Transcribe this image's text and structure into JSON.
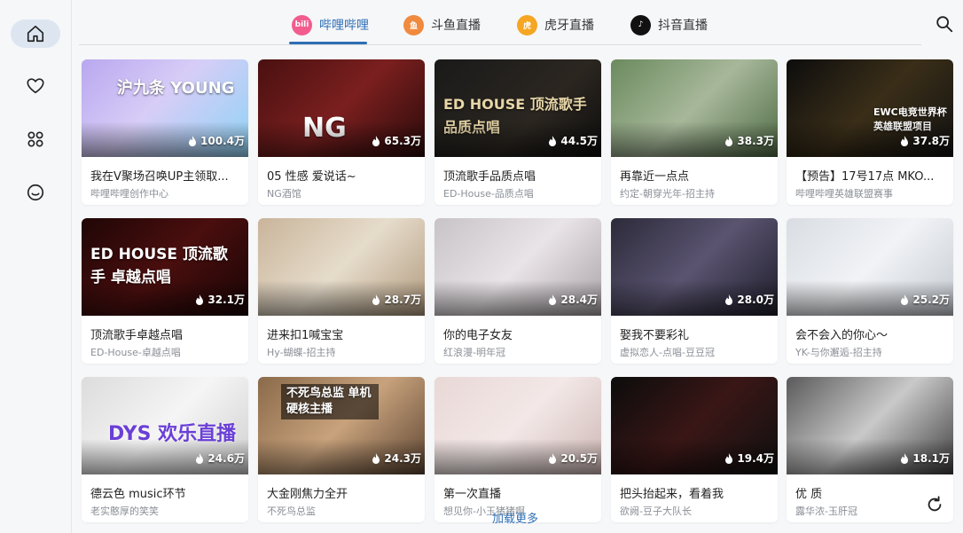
{
  "sidebar": {
    "items": [
      {
        "icon": "home-icon",
        "active": true
      },
      {
        "icon": "heart-icon",
        "active": false
      },
      {
        "icon": "grid-icon",
        "active": false
      },
      {
        "icon": "smile-icon",
        "active": false
      }
    ]
  },
  "tabs": [
    {
      "label": "哔哩哔哩",
      "icon": "bilibili-icon",
      "icon_text": "bili",
      "color": "#f25d8e",
      "active": true
    },
    {
      "label": "斗鱼直播",
      "icon": "douyu-icon",
      "icon_text": "鱼",
      "color": "#f08a3e",
      "active": false
    },
    {
      "label": "虎牙直播",
      "icon": "huya-icon",
      "icon_text": "虎",
      "color": "#f5a623",
      "active": false
    },
    {
      "label": "抖音直播",
      "icon": "douyin-icon",
      "icon_text": "♪",
      "color": "#111111",
      "active": false
    }
  ],
  "accent_color": "#2f6fb5",
  "cards": [
    {
      "title": "我在V聚场召唤UP主领取...",
      "streamer": "哔哩哔哩创作中心",
      "viewers": "100.4万",
      "overlay": "沪九条 YOUNG"
    },
    {
      "title": "05 性感 爱说话~",
      "streamer": "NG酒馆",
      "viewers": "65.3万",
      "overlay": "NG"
    },
    {
      "title": "顶流歌手品质点唱",
      "streamer": "ED-House-品质点唱",
      "viewers": "44.5万",
      "overlay": "ED HOUSE 顶流歌手 品质点唱"
    },
    {
      "title": "再靠近一点点",
      "streamer": "约定-朝穿光年-招主持",
      "viewers": "38.3万",
      "overlay": ""
    },
    {
      "title": "【预告】17号17点 MKO...",
      "streamer": "哔哩哔哩英雄联盟赛事",
      "viewers": "37.8万",
      "overlay": "EWC电竞世界杯 英雄联盟项目"
    },
    {
      "title": "顶流歌手卓越点唱",
      "streamer": "ED-House-卓越点唱",
      "viewers": "32.1万",
      "overlay": "ED HOUSE 顶流歌手 卓越点唱"
    },
    {
      "title": "进来扣1喊宝宝",
      "streamer": "Hy-蝴蝶-招主持",
      "viewers": "28.7万",
      "overlay": ""
    },
    {
      "title": "你的电子女友",
      "streamer": "红浪漫-明年冠",
      "viewers": "28.4万",
      "overlay": ""
    },
    {
      "title": "娶我不要彩礼",
      "streamer": "虚拟恋人-点唱-豆豆冠",
      "viewers": "28.0万",
      "overlay": ""
    },
    {
      "title": "会不会入的你心～",
      "streamer": "YK-与你邂逅-招主持",
      "viewers": "25.2万",
      "overlay": ""
    },
    {
      "title": "德云色 music环节",
      "streamer": "老实憨厚的笑笑",
      "viewers": "24.6万",
      "overlay": "DYS 欢乐直播"
    },
    {
      "title": "大金刚焦力全开",
      "streamer": "不死鸟总监",
      "viewers": "24.3万",
      "overlay": "不死鸟总监 单机硬核主播"
    },
    {
      "title": "第一次直播",
      "streamer": "想见你-小玉猪猪啊",
      "viewers": "20.5万",
      "overlay": ""
    },
    {
      "title": "把头抬起来，看着我",
      "streamer": "欲阙-豆子大队长",
      "viewers": "19.4万",
      "overlay": ""
    },
    {
      "title": "优 质",
      "streamer": "露华浓-玉肝冠",
      "viewers": "18.1万",
      "overlay": ""
    }
  ],
  "load_more": "加载更多"
}
